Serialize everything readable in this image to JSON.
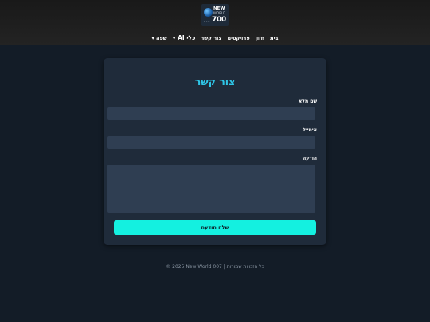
{
  "header": {
    "logo": {
      "line1": "NEW",
      "line2": "WORLD",
      "number": "700",
      "tag": "יצירה"
    }
  },
  "nav": {
    "items": [
      {
        "label": "בית"
      },
      {
        "label": "חזון"
      },
      {
        "label": "פרויקטים"
      },
      {
        "label": "צור קשר"
      },
      {
        "label": "כלי AI ▾"
      },
      {
        "label": "שפה ▾"
      }
    ]
  },
  "form": {
    "title": "צור קשר",
    "name_label": "שם מלא",
    "name_value": "",
    "email_label": "אימייל",
    "email_value": "",
    "message_label": "הודעה",
    "message_value": "",
    "submit_label": "שלח הודעה"
  },
  "footer": {
    "text": "© 2025 New World 007 | כל הזכויות שמורות"
  },
  "colors": {
    "accent": "#2ec5e6",
    "button": "#14f0e0",
    "page_bg": "#131c27",
    "card_bg": "#1f2b3a",
    "field_bg": "#2f3e52"
  }
}
